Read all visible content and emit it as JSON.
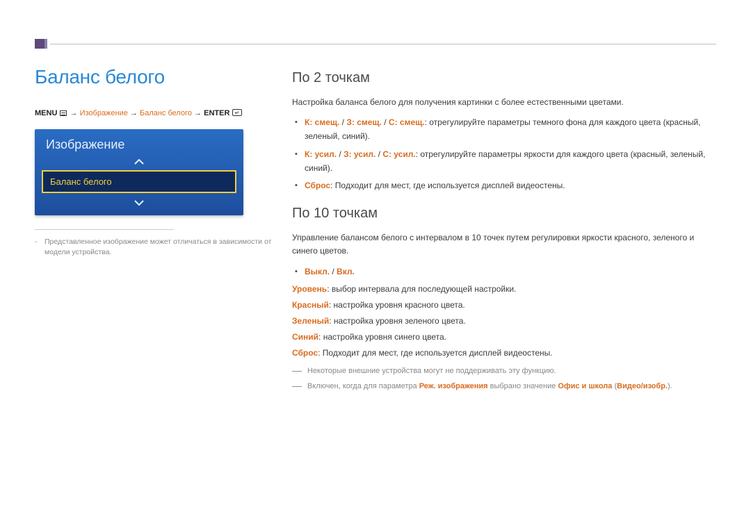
{
  "page": {
    "heading": "Баланс белого"
  },
  "breadcrumb": {
    "menu_label": "MENU",
    "arrow": "→",
    "step1": "Изображение",
    "step2": "Баланс белого",
    "enter_label": "ENTER"
  },
  "tv_menu": {
    "title": "Изображение",
    "selected_item": "Баланс белого"
  },
  "left_note": {
    "dash": "-",
    "text": "Представленное изображение может отличаться в зависимости от модели устройства."
  },
  "section1": {
    "heading": "По 2 точкам",
    "intro": "Настройка баланса белого для получения картинки с более естественными цветами.",
    "bullets": [
      {
        "label": "К: смещ.",
        "sep1": " / ",
        "label2": "З: смещ.",
        "sep2": " / ",
        "label3": "С: смещ.",
        "colon": ": ",
        "text": "отрегулируйте параметры темного фона для каждого цвета (красный, зеленый, синий)."
      },
      {
        "label": "К: усил.",
        "sep1": " / ",
        "label2": "З: усил.",
        "sep2": " / ",
        "label3": "С: усил.",
        "colon": ": ",
        "text": "отрегулируйте параметры яркости для каждого цвета (красный, зеленый, синий)."
      },
      {
        "label": "Сброс",
        "colon": ": ",
        "text": "Подходит для мест, где используется дисплей видеостены."
      }
    ]
  },
  "section2": {
    "heading": "По 10 точкам",
    "intro": "Управление балансом белого с интервалом в 10 точек путем регулировки яркости красного, зеленого и синего цветов.",
    "bullet_label1": "Выкл.",
    "bullet_sep": " / ",
    "bullet_label2": "Вкл.",
    "defs": [
      {
        "term": "Уровень",
        "text": "выбор интервала для последующей настройки."
      },
      {
        "term": "Красный",
        "text": "настройка уровня красного цвета."
      },
      {
        "term": "Зеленый",
        "text": "настройка уровня зеленого цвета."
      },
      {
        "term": "Синий",
        "text": "настройка уровня синего цвета."
      },
      {
        "term": "Сброс",
        "text": "Подходит для мест, где используется дисплей видеостены."
      }
    ],
    "footnotes": [
      {
        "dash": "―",
        "segments": [
          {
            "text": "Некоторые внешние устройства могут не поддерживать эту функцию.",
            "cls": ""
          }
        ]
      },
      {
        "dash": "―",
        "segments": [
          {
            "text": "Включен, когда для параметра ",
            "cls": ""
          },
          {
            "text": "Реж. изображения",
            "cls": "orange bold"
          },
          {
            "text": " выбрано значение ",
            "cls": ""
          },
          {
            "text": "Офис и школа",
            "cls": "orange bold"
          },
          {
            "text": " (",
            "cls": ""
          },
          {
            "text": "Видео/изобр.",
            "cls": "orange bold"
          },
          {
            "text": ").",
            "cls": ""
          }
        ]
      }
    ]
  }
}
